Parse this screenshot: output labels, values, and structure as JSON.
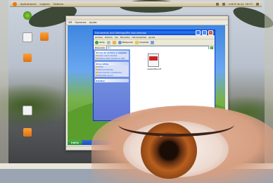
{
  "top_panel": {
    "menus": [
      "Aplicaciones",
      "Lugares",
      "Sistema"
    ],
    "clock": "mié 8 de jul, 18:57"
  },
  "desktop_icons": [
    {
      "name": "",
      "kind": "green"
    },
    {
      "name": "",
      "kind": "doc"
    },
    {
      "name": "",
      "kind": "folder"
    },
    {
      "name": "",
      "kind": "folder"
    },
    {
      "name": "",
      "kind": "doc"
    },
    {
      "name": "",
      "kind": "folder"
    }
  ],
  "host_window": {
    "title": "",
    "menus": [
      "VM",
      "Opciones",
      "Ayuda"
    ]
  },
  "explorer": {
    "title": "Documents and Settings\\Mis documentos",
    "menus": [
      "Archivo",
      "Edición",
      "Ver",
      "Favoritos",
      "Herramientas",
      "Ayuda"
    ],
    "toolbar": {
      "back": "Atrás",
      "search": "Búsqueda",
      "folders": "Carpetas"
    },
    "address_label": "Dirección",
    "address_value": "d:\\",
    "go": "Ir",
    "task_sections": [
      {
        "title": "Tareas de archivo y carpeta",
        "items": [
          "Crear nueva carpeta",
          "Publicar esta carpeta en Web"
        ]
      },
      {
        "title": "Otros sitios",
        "items": [
          "Mi PC",
          "Mis documentos",
          "Documentos compartidos",
          "Mis sitios de red"
        ]
      },
      {
        "title": "Detalles",
        "items": []
      }
    ],
    "file": {
      "name": "newsletter.pdf"
    }
  },
  "xp_taskbar": {
    "start_label": "Inicio"
  }
}
